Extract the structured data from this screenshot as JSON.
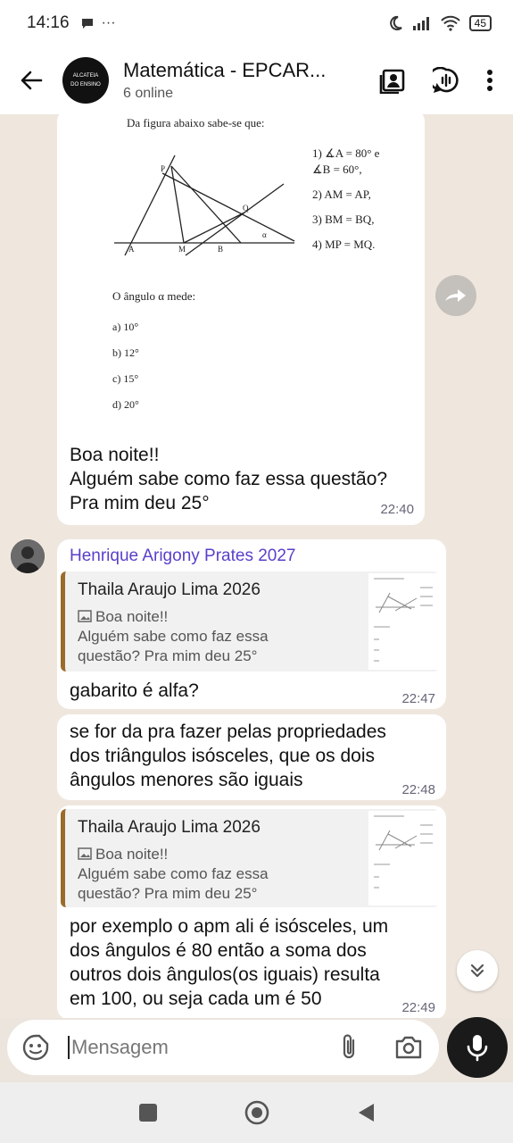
{
  "status": {
    "time": "14:16",
    "more": "···",
    "battery": "45"
  },
  "header": {
    "title": "Matemática - EPCAR...",
    "subtitle": "6 online",
    "avatar_text": "ALCATEIA DO ENSINO"
  },
  "question_image": {
    "intro": "Da figura abaixo sabe-se que:",
    "given": [
      "1) ∡A = 80° e",
      "∡B = 60°,",
      "2) AM = AP,",
      "3) BM = BQ,",
      "4) MP = MQ."
    ],
    "question": "O ângulo α mede:",
    "options": [
      "a) 10°",
      "b) 12°",
      "c) 15°",
      "d) 20°"
    ],
    "point_labels": [
      "P",
      "Q",
      "A",
      "M",
      "B",
      "α"
    ]
  },
  "messages": {
    "first": {
      "lines": [
        "Boa noite!!",
        "Alguém sabe como faz essa questão?",
        "Pra mim deu 25°"
      ],
      "time": "22:40"
    },
    "sender": "Henrique Arigony Prates 2027",
    "reply1": {
      "quote_name": "Thaila Araujo Lima 2026",
      "quote_lines": [
        "Boa noite!!",
        "Alguém sabe como faz essa",
        "questão? Pra mim deu 25°"
      ],
      "text": "gabarito é alfa?",
      "time": "22:47"
    },
    "second": {
      "lines": [
        "se for da pra fazer pelas propriedades",
        "dos triângulos isósceles, que os dois",
        "ângulos menores são iguais"
      ],
      "time": "22:48"
    },
    "reply2": {
      "quote_name": "Thaila Araujo Lima 2026",
      "quote_lines": [
        "Boa noite!!",
        "Alguém sabe como faz essa",
        "questão? Pra mim deu 25°"
      ],
      "lines": [
        "por exemplo o apm ali é isósceles, um",
        "dos ângulos é 80 então a soma dos",
        "outros dois ângulos(os iguais) resulta",
        "em 100, ou seja cada um é 50"
      ],
      "time": "22:49"
    }
  },
  "input": {
    "placeholder": "Mensagem"
  },
  "colors": {
    "sender": "#5B3FCB",
    "quote_bar": "#9A6B2A",
    "mic": "#1a1a1a"
  },
  "icons": [
    "back-arrow-icon",
    "contact-card-icon",
    "group-call-icon",
    "more-vert-icon",
    "forward-icon",
    "scroll-down-icon",
    "sticker-icon",
    "attach-icon",
    "camera-icon",
    "mic-icon",
    "image-icon"
  ]
}
